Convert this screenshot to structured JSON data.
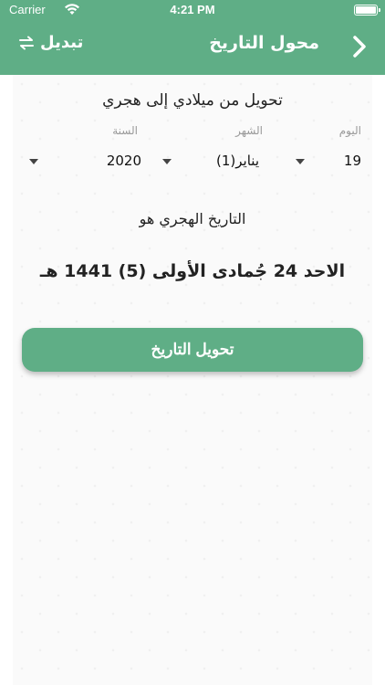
{
  "status_bar": {
    "carrier": "Carrier",
    "time": "4:21 PM"
  },
  "nav": {
    "title": "محول التاريخ",
    "swap_label": "تبديل"
  },
  "converter": {
    "heading": "تحويل من ميلادي إلى هجري",
    "labels": {
      "day": "اليوم",
      "month": "الشهر",
      "year": "السنة"
    },
    "values": {
      "day": "19",
      "month": "يناير(1)",
      "year": "2020"
    },
    "result_label": "التاريخ الهجري هو",
    "result_value": "الاحد 24 جُمادى الأولى (5) 1441 هـ",
    "convert_button": "تحويل التاريخ"
  },
  "colors": {
    "primary": "#5fae86",
    "background": "#fafafa"
  },
  "icons": {
    "back": "chevron-right-icon",
    "swap": "swap-arrows-icon",
    "wifi": "wifi-icon",
    "battery": "battery-icon",
    "dropdown": "caret-down-icon"
  }
}
